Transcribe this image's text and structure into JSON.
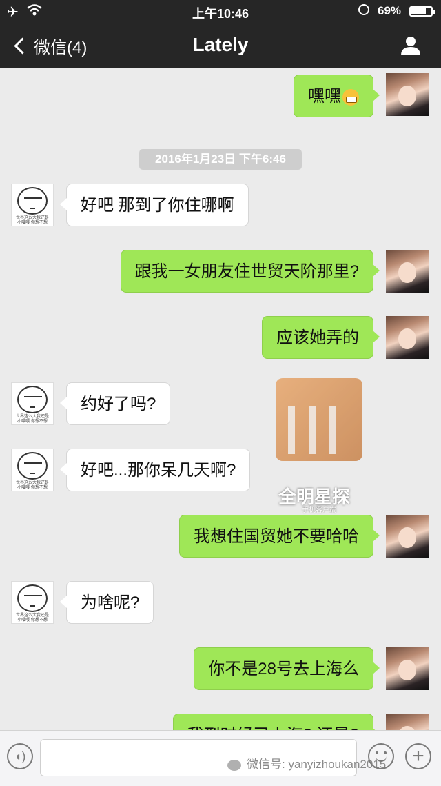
{
  "status_bar": {
    "time": "上午10:46",
    "battery": "69%",
    "battery_level": 0.69
  },
  "nav": {
    "back_label": "微信(4)",
    "title": "Lately"
  },
  "timestamp": "2016年1月23日  下午6:46",
  "messages": [
    {
      "side": "out",
      "text": "嘿嘿",
      "emoji": "grinning-face"
    },
    {
      "side": "in",
      "text": "好吧 那到了你住哪啊"
    },
    {
      "side": "out",
      "text": "跟我一女朋友住世贸天阶那里?"
    },
    {
      "side": "out",
      "text": "应该她弄的"
    },
    {
      "side": "in",
      "text": "约好了吗?"
    },
    {
      "side": "in",
      "text": "好吧...那你呆几天啊?"
    },
    {
      "side": "out",
      "text": "我想住国贸她不要哈哈"
    },
    {
      "side": "in",
      "text": "为啥呢?"
    },
    {
      "side": "out",
      "text": "你不是28号去上海么"
    },
    {
      "side": "out",
      "text": "我到时候已上海?  还是?"
    }
  ],
  "meme_avatar_caption": "世界这么大我还是小嘤嘤 你想不想",
  "watermark": {
    "title": "全明星探",
    "subtitle": "手机客户端"
  },
  "input": {
    "wechat_watermark": "微信号: yanyizhoukan2015"
  }
}
